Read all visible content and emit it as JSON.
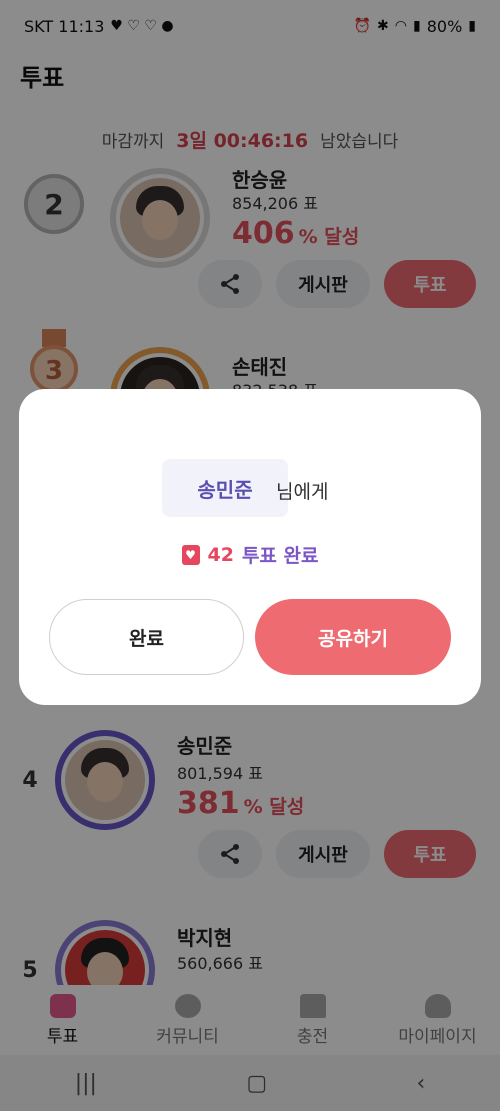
{
  "status_bar": {
    "carrier_time": "SKT 11:13",
    "battery": "80%"
  },
  "header": {
    "title": "투표"
  },
  "deadline": {
    "prefix": "마감까지",
    "time": "3일 00:46:16",
    "suffix": "남았습니다"
  },
  "ranking": [
    {
      "rank": "2",
      "name": "한승윤",
      "votes": "854,206 표",
      "percent": "406",
      "unit": "% 달성"
    },
    {
      "rank": "3",
      "name": "손태진",
      "votes": "832,538 표"
    },
    {
      "rank": "4",
      "name": "송민준",
      "votes": "801,594 표",
      "percent": "381",
      "unit": "% 달성"
    },
    {
      "rank": "5",
      "name": "박지현",
      "votes": "560,666 표"
    }
  ],
  "actions": {
    "board": "게시판",
    "vote": "투표"
  },
  "modal": {
    "name": "송민준",
    "suffix": "님에게",
    "result_count": "42",
    "result_label": "투표 완료",
    "done_label": "완료",
    "share_label": "공유하기"
  },
  "tabs": [
    {
      "label": "투표",
      "icon": "vote-heart-icon"
    },
    {
      "label": "커뮤니티",
      "icon": "chat-bubble-icon"
    },
    {
      "label": "충전",
      "icon": "shirt-icon"
    },
    {
      "label": "마이페이지",
      "icon": "person-icon"
    }
  ]
}
